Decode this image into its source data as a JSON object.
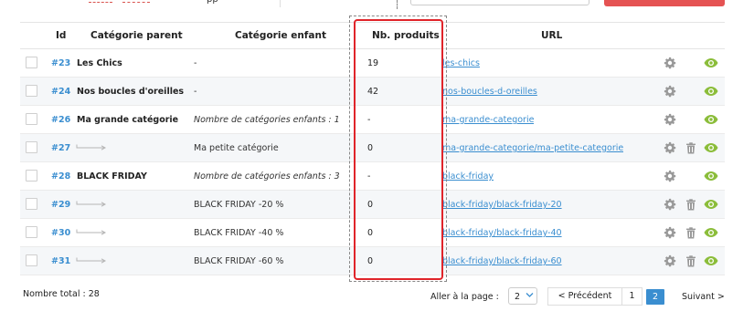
{
  "toolbar": {
    "partial_label": "pp"
  },
  "table": {
    "headers": {
      "id": "Id",
      "parent": "Catégorie parent",
      "child": "Catégorie enfant",
      "count": "Nb. produits",
      "url": "URL"
    },
    "rows": [
      {
        "id": "#23",
        "parent": "Les Chics",
        "child": "-",
        "child_italic": false,
        "count": "19",
        "url": "les-chics",
        "has_delete": false
      },
      {
        "id": "#24",
        "parent": "Nos boucles d'oreilles",
        "child": "-",
        "child_italic": false,
        "count": "42",
        "url": "nos-boucles-d-oreilles",
        "has_delete": false
      },
      {
        "id": "#26",
        "parent": "Ma grande catégorie",
        "child": "Nombre de catégories enfants : 1",
        "child_italic": true,
        "count": "-",
        "url": "ma-grande-categorie",
        "has_delete": false
      },
      {
        "id": "#27",
        "parent": "",
        "child": "Ma petite catégorie",
        "child_italic": false,
        "count": "0",
        "url": "ma-grande-categorie/ma-petite-categorie",
        "has_delete": true
      },
      {
        "id": "#28",
        "parent": "BLACK FRIDAY",
        "child": "Nombre de catégories enfants : 3",
        "child_italic": true,
        "count": "-",
        "url": "black-friday",
        "has_delete": false
      },
      {
        "id": "#29",
        "parent": "",
        "child": "BLACK FRIDAY -20 %",
        "child_italic": false,
        "count": "0",
        "url": "black-friday/black-friday-20",
        "has_delete": true
      },
      {
        "id": "#30",
        "parent": "",
        "child": "BLACK FRIDAY -40 %",
        "child_italic": false,
        "count": "0",
        "url": "black-friday/black-friday-40",
        "has_delete": true
      },
      {
        "id": "#31",
        "parent": "",
        "child": "BLACK FRIDAY -60 %",
        "child_italic": false,
        "count": "0",
        "url": "black-friday/black-friday-60",
        "has_delete": true
      }
    ]
  },
  "footer": {
    "total": "Nombre total : 28",
    "goto_label": "Aller à la page :",
    "page_select_value": "2",
    "prev_label": "< Précédent",
    "page1": "1",
    "page2": "2",
    "next_label": "Suivant >"
  },
  "colors": {
    "link": "#3a8ed0",
    "highlight": "#e0242a",
    "view_icon": "#8bbd3a",
    "action_icon": "#999999"
  },
  "icons": {
    "settings": "gear-icon",
    "delete": "trash-icon",
    "view": "eye-icon",
    "sub_arrow": "sub-category-arrow-icon",
    "select": "chevron-down-icon"
  }
}
